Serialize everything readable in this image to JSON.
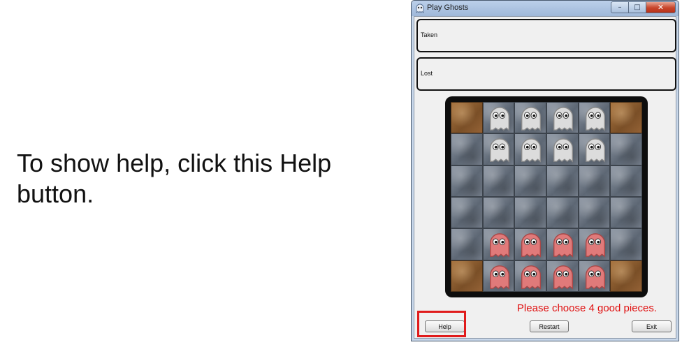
{
  "callout": {
    "text_before": "To show help, click this ",
    "emphasis": "Help",
    "text_after": " button."
  },
  "window": {
    "title": "Play Ghosts",
    "icon": "ghost-app-icon",
    "controls": {
      "minimize": "–",
      "maximize": "□",
      "close": "✕"
    }
  },
  "panels": {
    "taken_label": "Taken",
    "lost_label": "Lost"
  },
  "board": {
    "rows": [
      [
        "corner",
        "white",
        "white",
        "white",
        "white",
        "corner"
      ],
      [
        "empty",
        "white",
        "white",
        "white",
        "white",
        "empty"
      ],
      [
        "empty",
        "empty",
        "empty",
        "empty",
        "empty",
        "empty"
      ],
      [
        "empty",
        "empty",
        "empty",
        "empty",
        "empty",
        "empty"
      ],
      [
        "empty",
        "red",
        "red",
        "red",
        "red",
        "empty"
      ],
      [
        "corner",
        "red",
        "red",
        "red",
        "red",
        "corner"
      ]
    ],
    "colors": {
      "white_ghost": "#dcdcdc",
      "red_ghost": "#e07a7a"
    }
  },
  "status": {
    "message": "Please choose 4 good pieces.",
    "color": "#e01010"
  },
  "buttons": {
    "help": "Help",
    "restart": "Restart",
    "exit": "Exit"
  },
  "highlight_color": "#e01b1b"
}
